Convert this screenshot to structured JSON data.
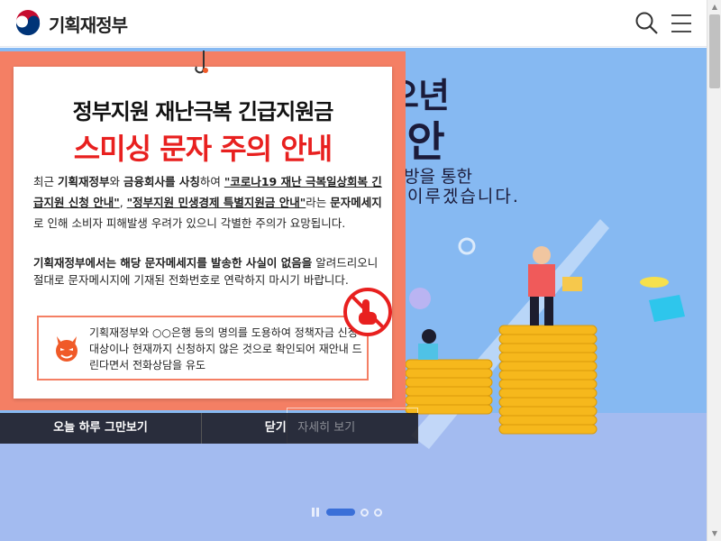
{
  "header": {
    "logo_text": "기획재정부",
    "search_icon": "search-icon",
    "menu_icon": "hamburger-menu-icon"
  },
  "hero": {
    "title_line1": "오년",
    "title_line2": "편안",
    "subtitle_line1": "방을 통한",
    "subtitle_line2": "이루겠습니다.",
    "background_color": "#86b9f2",
    "active_slide_index": 1,
    "slide_count": 3
  },
  "popup": {
    "title_line1": "정부지원 재난극복 긴급지원금",
    "title_line2": "스미싱 문자 주의 안내",
    "para1": {
      "t1": "최근 ",
      "t2": "기획재정부",
      "t3": "와 ",
      "t4": "금융회사를 사칭",
      "t5": "하여 ",
      "t6": "\"코로나19 재난 극복일상회복 긴급지원 신청 안내\"",
      "t7": ", ",
      "t8": "\"정부지원 민생경제 특별지원금 안내\"",
      "t9": "라는 ",
      "t10": "문자메세지",
      "t11": "로 인해 소비자 피해발생 우려가 있으니 각별한 주의가 요망됩니다."
    },
    "para2": {
      "t1": "기획재정부에서는 해당 문자메세지를 발송한 사실이 없음을",
      "t2": " 알려드리오니 절대로 문자메시지에 기재된 전화번호로 연락하지 마시기 바랍니다."
    },
    "warning": "기획재정부와 ○○은행 등의 명의를 도용하여 정책자금 신청대상이나 현재까지 신청하지 않은 것으로 확인되어 재안내 드린다면서 전화상담을 유도",
    "accent_color": "#f47f64",
    "alert_color": "#e8201f"
  },
  "popup_bar": {
    "today_close_label": "오늘 하루 그만보기",
    "close_label": "닫기",
    "hidden_button_label": "자세히 보기"
  }
}
